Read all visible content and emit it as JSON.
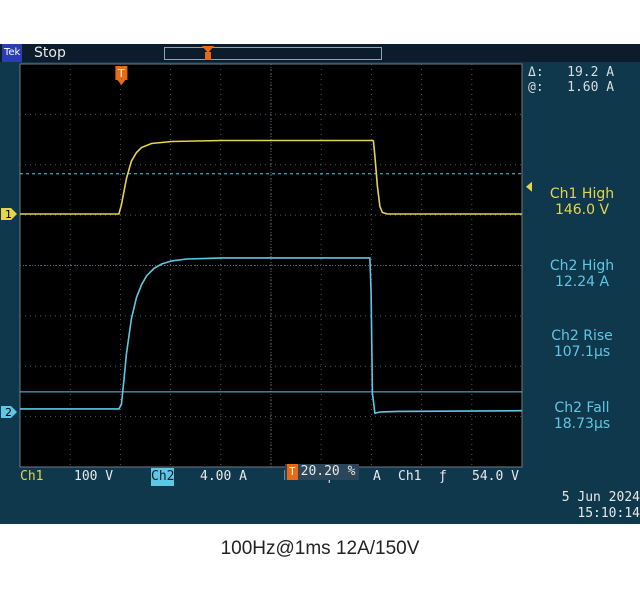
{
  "header": {
    "brand": "Tek",
    "run_state": "Stop"
  },
  "cursors": {
    "delta_label": "Δ:",
    "delta_value": "19.2 A",
    "at_label": "@:",
    "at_value": "1.60 A"
  },
  "measurements": [
    {
      "label": "Ch1 High",
      "value": "146.0 V"
    },
    {
      "label": "Ch2 High",
      "value": "12.24 A"
    },
    {
      "label": "Ch2 Rise",
      "value": "107.1µs"
    },
    {
      "label": "Ch2 Fall",
      "value": "18.73µs"
    }
  ],
  "settings": {
    "ch1_label": "Ch1",
    "ch1_scale": "100 V",
    "ch2_label": "Ch2",
    "ch2_scale": "4.00 A",
    "timebase_label": "M",
    "timebase": "200µs",
    "trigger_mode": "A",
    "trigger_source": "Ch1",
    "trigger_slope": "ƒ",
    "trigger_level": "54.0 V",
    "trigger_position": "20.20 %"
  },
  "date": "5 Jun  2024",
  "time": "15:10:14",
  "caption": "100Hz@1ms 12A/150V",
  "markers": {
    "ch1": "1",
    "ch2": "2",
    "trigger": "T"
  },
  "colors": {
    "ch1": "#e4d450",
    "ch2": "#5ec8e4",
    "background": "#0c1c2c",
    "accent": "#e86a14"
  },
  "chart_data": {
    "type": "line",
    "x_unit": "µs",
    "xlim": [
      -404,
      1596
    ],
    "series": [
      {
        "name": "Ch1",
        "unit": "V",
        "x": [
          -404,
          -10,
          0,
          20,
          40,
          60,
          80,
          120,
          200,
          400,
          600,
          800,
          1000,
          1004,
          1010,
          1020,
          1030,
          1040,
          1060,
          1100,
          1596
        ],
        "y": [
          0,
          0,
          18,
          70,
          105,
          122,
          132,
          140,
          144,
          146,
          146,
          146,
          146,
          145,
          115,
          55,
          15,
          3,
          0,
          0,
          0
        ]
      },
      {
        "name": "Ch2",
        "unit": "A",
        "x": [
          -404,
          -10,
          0,
          10,
          20,
          40,
          60,
          80,
          100,
          130,
          160,
          200,
          260,
          340,
          400,
          600,
          800,
          980,
          990,
          995,
          1000,
          1010,
          1030,
          1100,
          1596
        ],
        "y": [
          0.25,
          0.25,
          0.6,
          2.5,
          4.6,
          7.4,
          9.1,
          10.1,
          10.8,
          11.4,
          11.75,
          12.0,
          12.15,
          12.2,
          12.24,
          12.24,
          12.24,
          12.24,
          12.24,
          9.5,
          1.5,
          -0.1,
          0.0,
          0.05,
          0.1
        ]
      }
    ],
    "cursor_level_ch2": 1.6
  }
}
